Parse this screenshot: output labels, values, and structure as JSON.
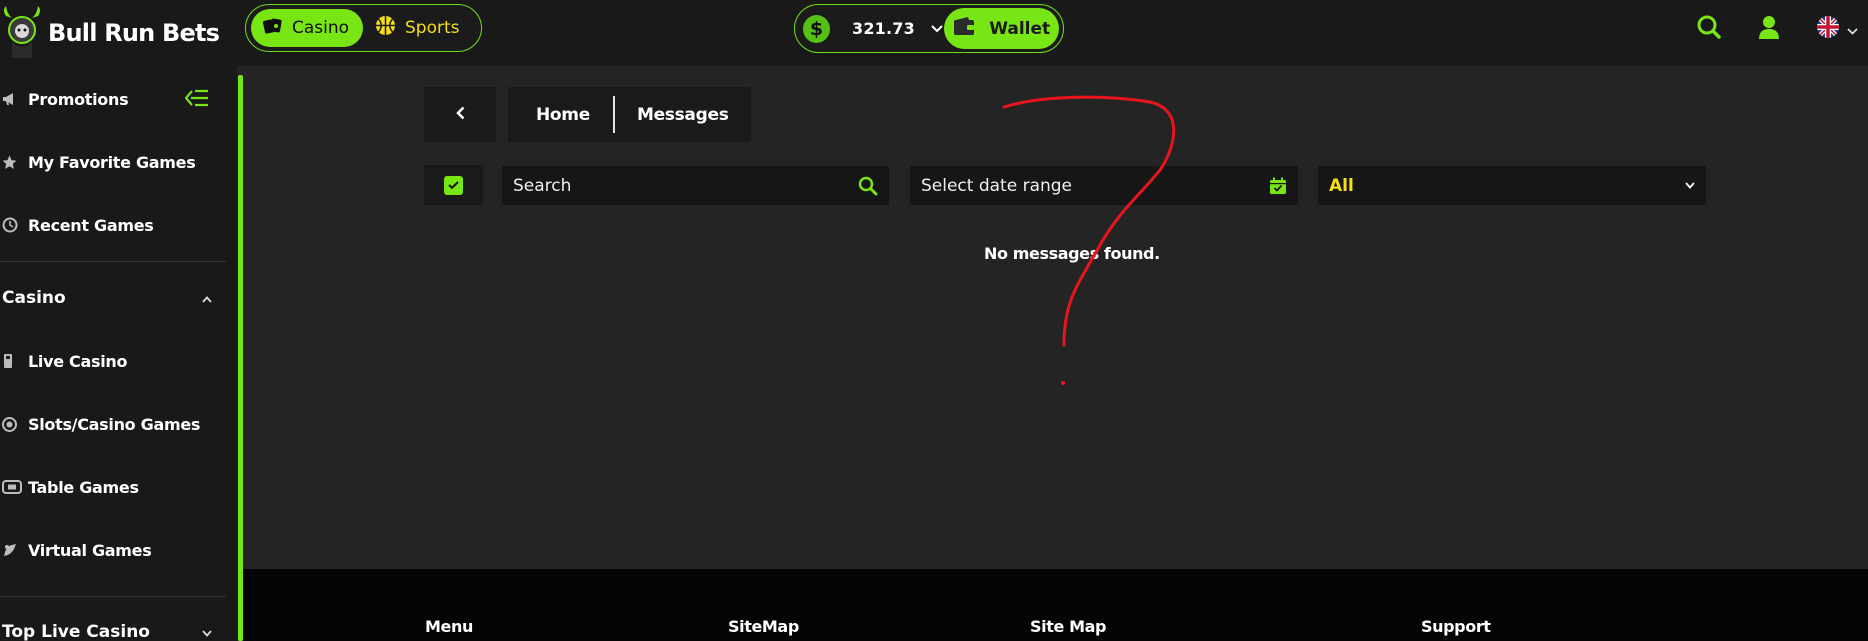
{
  "brand": {
    "name": "Bull Run Bets"
  },
  "mode_switch": {
    "casino_label": "Casino",
    "sports_label": "Sports"
  },
  "balance": {
    "amount": "321.73",
    "currency_icon": "$",
    "wallet_label": "Wallet"
  },
  "header_icons": [
    "search-icon",
    "user-icon",
    "uk-flag-icon",
    "chevron-down-icon"
  ],
  "sidebar": {
    "top_items": [
      {
        "label": "Promotions",
        "icon": "megaphone-icon"
      },
      {
        "label": "My Favorite Games",
        "icon": "star-icon"
      },
      {
        "label": "Recent Games",
        "icon": "history-icon"
      }
    ],
    "casino_section": {
      "title": "Casino",
      "items": [
        {
          "label": "Live Casino",
          "icon": "dealer-icon"
        },
        {
          "label": "Slots/Casino Games",
          "icon": "chip-icon"
        },
        {
          "label": "Table Games",
          "icon": "table-icon"
        },
        {
          "label": "Virtual Games",
          "icon": "virtual-icon"
        }
      ]
    },
    "top_live_casino": {
      "title": "Top Live Casino"
    }
  },
  "breadcrumb": {
    "home": "Home",
    "current": "Messages"
  },
  "filters": {
    "search_placeholder": "Search",
    "date_placeholder": "Select date range",
    "type_selected": "All"
  },
  "messages": {
    "empty_text": "No messages found."
  },
  "footer": {
    "columns": [
      "Menu",
      "SiteMap",
      "Site Map",
      "Support"
    ]
  },
  "colors": {
    "accent_green": "#78e614",
    "accent_yellow": "#f5dd18",
    "annotation_red": "#e8141e"
  }
}
